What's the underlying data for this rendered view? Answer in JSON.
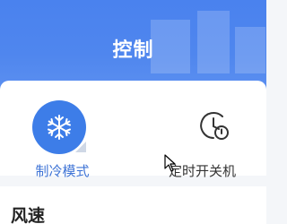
{
  "header": {
    "title": "控制"
  },
  "modes": [
    {
      "label": "制冷模式",
      "icon": "snowflake-icon",
      "active": true
    },
    {
      "label": "定时开关机",
      "icon": "timer-clock-icon",
      "active": false
    }
  ],
  "fan_speed": {
    "title": "风速"
  },
  "colors": {
    "header_blue": "#4a82ee",
    "active_blue": "#3d7de8",
    "active_text": "#3f74d6"
  }
}
